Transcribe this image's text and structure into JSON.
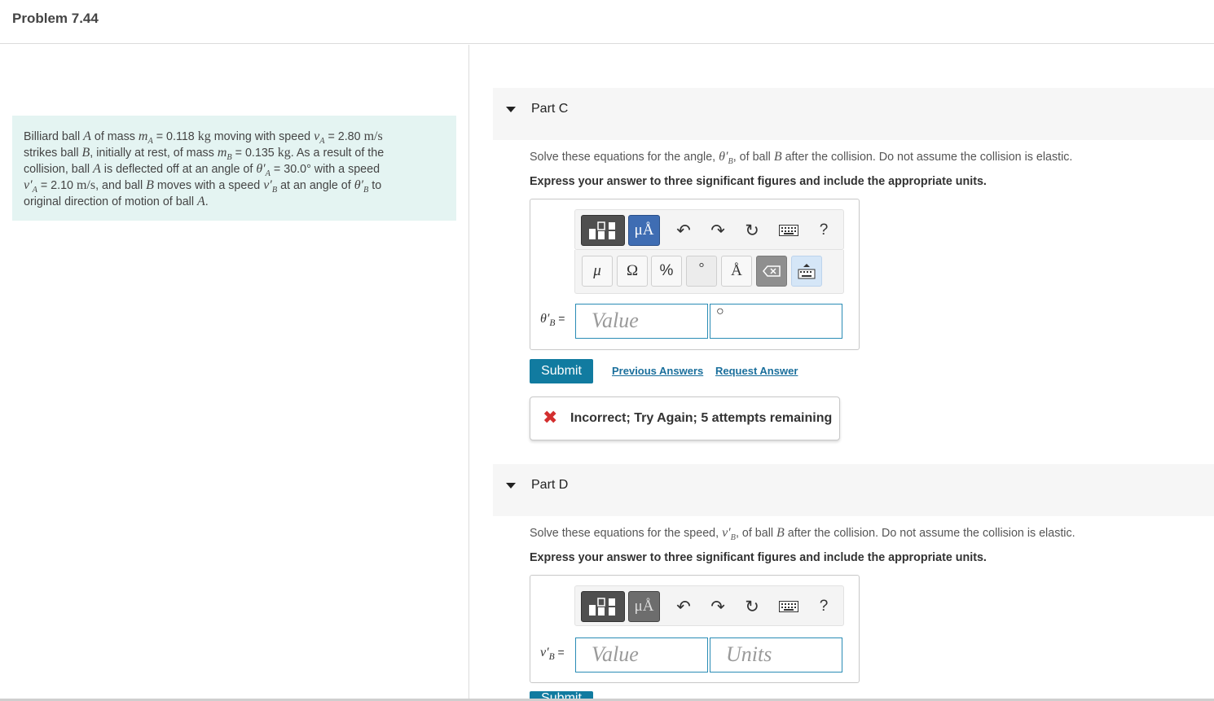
{
  "header": {
    "title": "Problem 7.44"
  },
  "problem": {
    "t1": "Billiard ball ",
    "ballA": "A",
    "t2": " of mass ",
    "mA_sym": "m",
    "mA_sub": "A",
    "mA_val": " = 0.118 ",
    "kg1": "kg",
    "t3": " moving with speed ",
    "vA_sym": "v",
    "vA_sub": "A",
    "vA_val": " = 2.80 ",
    "ms1": "m/s",
    "t4": "strikes ball ",
    "ballB": "B",
    "t5": ", initially at rest, of mass ",
    "mB_sym": "m",
    "mB_sub": "B",
    "mB_val": " = 0.135 ",
    "kg2": "kg",
    "t6": ". As a result of the",
    "t7": "collision, ball ",
    "ballA2": "A",
    "t8": " is deflected off at an angle of ",
    "thA_sym": "θ′",
    "thA_sub": "A",
    "thA_val": " = 30.0° with a speed",
    "vpA_sym": "v′",
    "vpA_sub": "A",
    "vpA_val": " = 2.10 ",
    "ms2": "m/s",
    "t9": ", and ball ",
    "ballB2": "B",
    "t10": " moves with a speed ",
    "vpB_sym": "v′",
    "vpB_sub": "B",
    "t11": " at an angle of ",
    "thB_sym": "θ′",
    "thB_sub": "B",
    "t12": " to",
    "t13": "original direction of motion of ball ",
    "ballA3": "A",
    "t14": "."
  },
  "partC": {
    "title": "Part C",
    "q1": "Solve these equations for the angle, ",
    "q_sym": "θ′",
    "q_sub": "B",
    "q2": ", of ball ",
    "q_ball": "B",
    "q3": " after the collision. Do not assume the collision is elastic.",
    "instruction": "Express your answer to three significant figures and include the appropriate units.",
    "var_sym": "θ′",
    "var_sub": "B",
    "var_eq": " =",
    "value_placeholder": "Value",
    "units_value": "○",
    "submit": "Submit",
    "previous_answers": "Previous Answers",
    "request_answer": "Request Answer",
    "feedback": "Incorrect; Try Again; 5 attempts remaining"
  },
  "partD": {
    "title": "Part D",
    "q1": "Solve these equations for the speed, ",
    "q_sym": "v′",
    "q_sub": "B",
    "q2": ", of ball ",
    "q_ball": "B",
    "q3": " after the collision. Do not assume the collision is elastic.",
    "instruction": "Express your answer to three significant figures and include the appropriate units.",
    "var_sym": "v′",
    "var_sub": "B",
    "var_eq": " =",
    "value_placeholder": "Value",
    "units_placeholder": "Units",
    "submit": "Submit"
  },
  "toolbar": {
    "units_label": "μÅ",
    "undo": "↶",
    "redo": "↷",
    "reset": "↻",
    "help": "?",
    "symbols": {
      "mu": "μ",
      "omega": "Ω",
      "percent": "%",
      "degree": "°",
      "angstrom": "Å",
      "backspace": "⌫"
    }
  },
  "colors": {
    "problem_bg": "#e4f4f2",
    "submit_bg": "#117ba0",
    "units_active": "#3f6db3",
    "incorrect": "#d32f2f",
    "input_border": "#2a8cb5"
  }
}
